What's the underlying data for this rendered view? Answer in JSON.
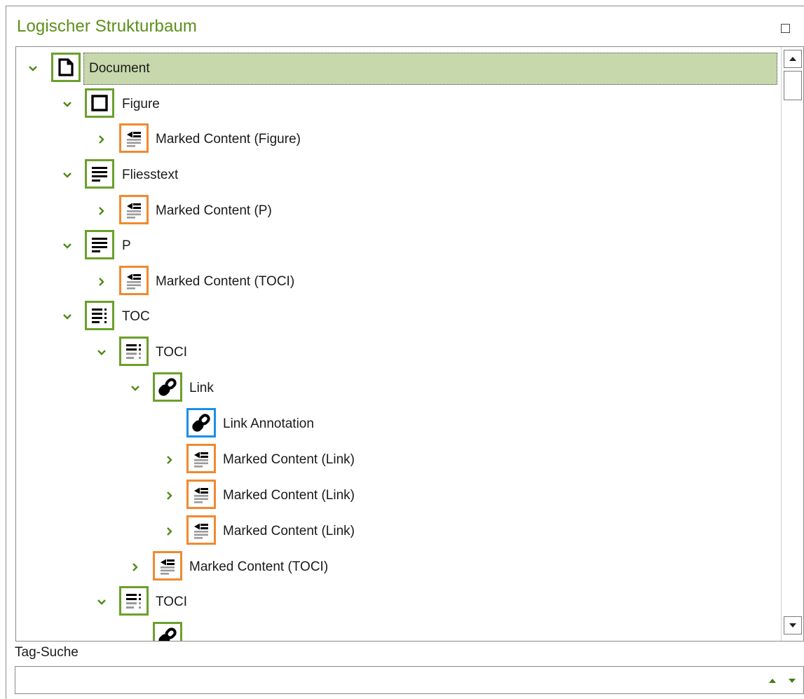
{
  "panel": {
    "title": "Logischer Strukturbaum",
    "maximize_icon": "maximize-icon"
  },
  "colors": {
    "accent_green": "#6aa02b",
    "title_green": "#5b8f1a",
    "marked_content_orange": "#ef8a30",
    "annotation_blue": "#1b8fe6",
    "selection_bg": "#c6d8ac"
  },
  "tree": {
    "nodes": [
      {
        "label": "Document",
        "icon": "document-icon",
        "expanded": true,
        "selected": true
      },
      {
        "label": "Figure",
        "icon": "figure-icon",
        "expanded": true
      },
      {
        "label": "Marked Content (Figure)",
        "icon": "marked-content-icon",
        "expanded": false
      },
      {
        "label": "Fliesstext",
        "icon": "paragraph-icon",
        "expanded": true
      },
      {
        "label": "Marked Content (P)",
        "icon": "marked-content-icon",
        "expanded": false
      },
      {
        "label": "P",
        "icon": "paragraph-icon",
        "expanded": true
      },
      {
        "label": "Marked Content (TOCI)",
        "icon": "marked-content-icon",
        "expanded": false
      },
      {
        "label": "TOC",
        "icon": "toc-icon",
        "expanded": true
      },
      {
        "label": "TOCI",
        "icon": "toci-icon",
        "expanded": true
      },
      {
        "label": "Link",
        "icon": "link-icon",
        "expanded": true
      },
      {
        "label": "Link Annotation",
        "icon": "link-annotation-icon"
      },
      {
        "label": "Marked Content (Link)",
        "icon": "marked-content-icon",
        "expanded": false
      },
      {
        "label": "Marked Content (Link)",
        "icon": "marked-content-icon",
        "expanded": false
      },
      {
        "label": "Marked Content (Link)",
        "icon": "marked-content-icon",
        "expanded": false
      },
      {
        "label": "Marked Content (TOCI)",
        "icon": "marked-content-icon",
        "expanded": false
      },
      {
        "label": "TOCI",
        "icon": "toci-icon",
        "expanded": true
      }
    ]
  },
  "scrollbar": {
    "up_icon": "scroll-up-icon",
    "down_icon": "scroll-down-icon"
  },
  "search": {
    "label": "Tag-Suche",
    "value": "",
    "prev_icon": "search-previous-icon",
    "next_icon": "search-next-icon"
  }
}
